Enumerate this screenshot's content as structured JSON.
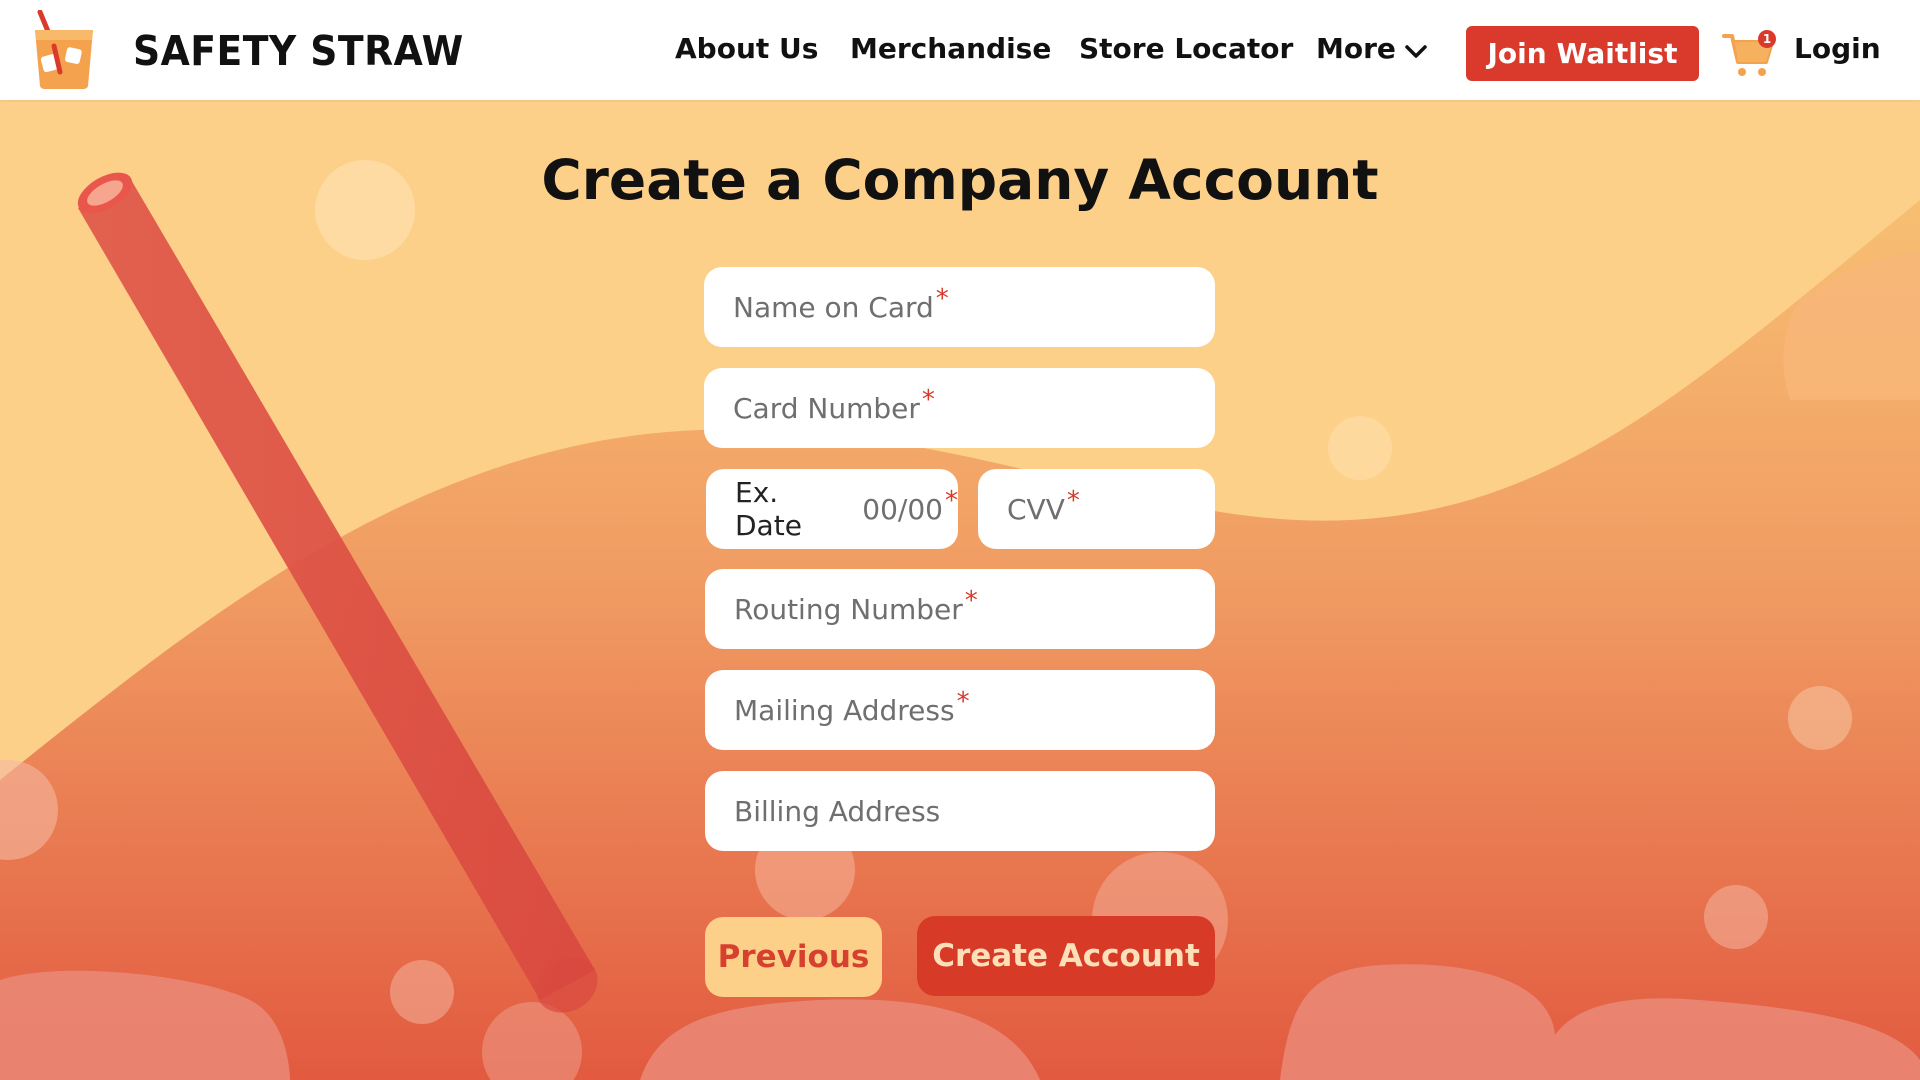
{
  "header": {
    "brand": "SAFETY STRAW",
    "nav": {
      "about": "About Us",
      "merch": "Merchandise",
      "locator": "Store Locator",
      "more": "More"
    },
    "join_label": "Join Waitlist",
    "cart_count": "1",
    "login_label": "Login"
  },
  "page": {
    "title": "Create a Company Account"
  },
  "form": {
    "name_on_card": "Name on Card",
    "card_number": "Card Number",
    "ex_date_label": "Ex. Date",
    "ex_date_placeholder": "00/00",
    "cvv": "CVV",
    "routing_number": "Routing Number",
    "mailing_address": "Mailing Address",
    "billing_address": "Billing Address",
    "required_mark": "*",
    "previous_label": "Previous",
    "create_label": "Create Account"
  },
  "colors": {
    "accent": "#d93a2b",
    "background_top": "#fdd08a",
    "background_bottom": "#e2573e"
  }
}
